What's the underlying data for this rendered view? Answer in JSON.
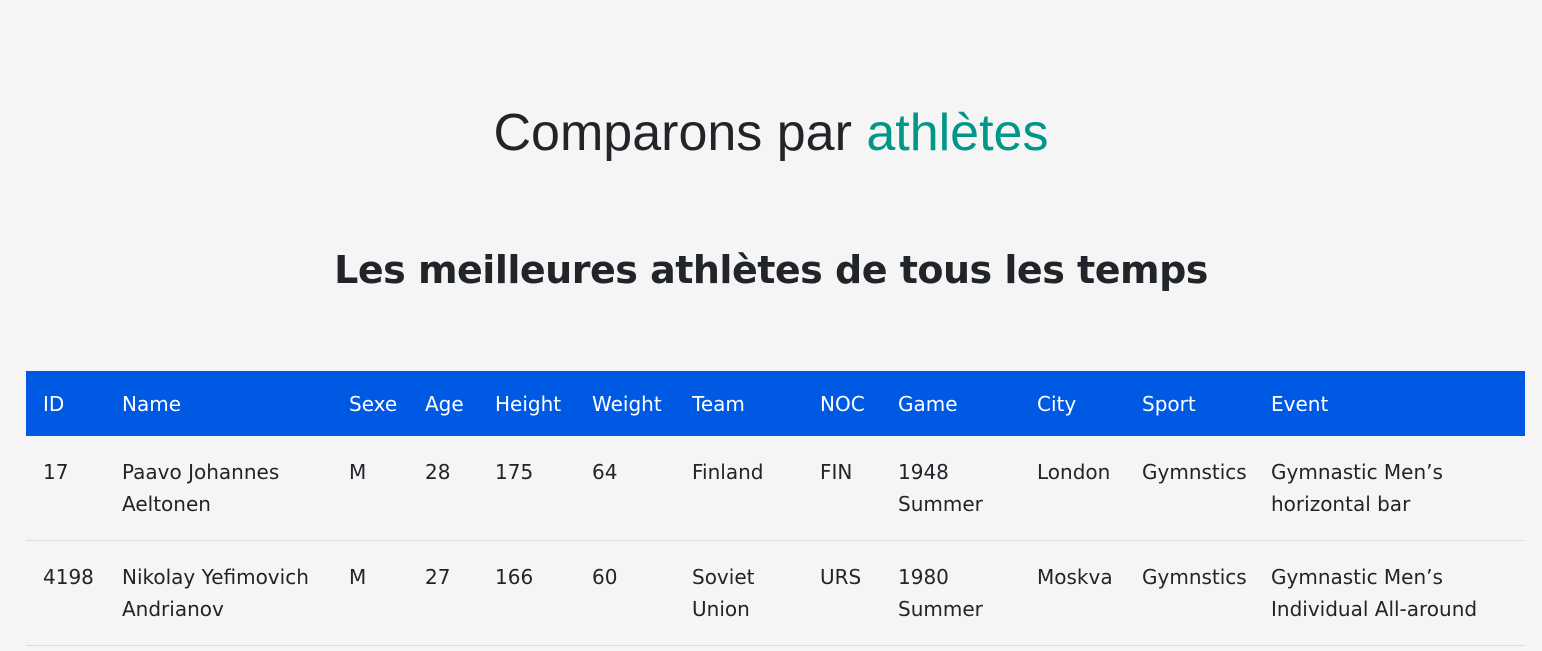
{
  "header": {
    "title_prefix": "Comparons par",
    "title_accent": "athlètes",
    "accent_color": "#009688"
  },
  "section": {
    "title": "Les meilleures athlètes de tous les temps"
  },
  "table": {
    "header_color": "#0059e3",
    "columns": [
      "ID",
      "Name",
      "Sexe",
      "Age",
      "Height",
      "Weight",
      "Team",
      "NOC",
      "Game",
      "City",
      "Sport",
      "Event"
    ],
    "rows": [
      [
        "17",
        "Paavo Johannes Aeltonen",
        "M",
        "28",
        "175",
        "64",
        "Finland",
        "FIN",
        "1948 Summer",
        "London",
        "Gymnstics",
        "Gymnastic Men’s horizontal bar"
      ],
      [
        "4198",
        "Nikolay Yefimovich Andrianov",
        "M",
        "27",
        "166",
        "60",
        "Soviet Union",
        "URS",
        "1980 Summer",
        "Moskva",
        "Gymnstics",
        "Gymnastic Men’s Individual All-around"
      ]
    ]
  }
}
